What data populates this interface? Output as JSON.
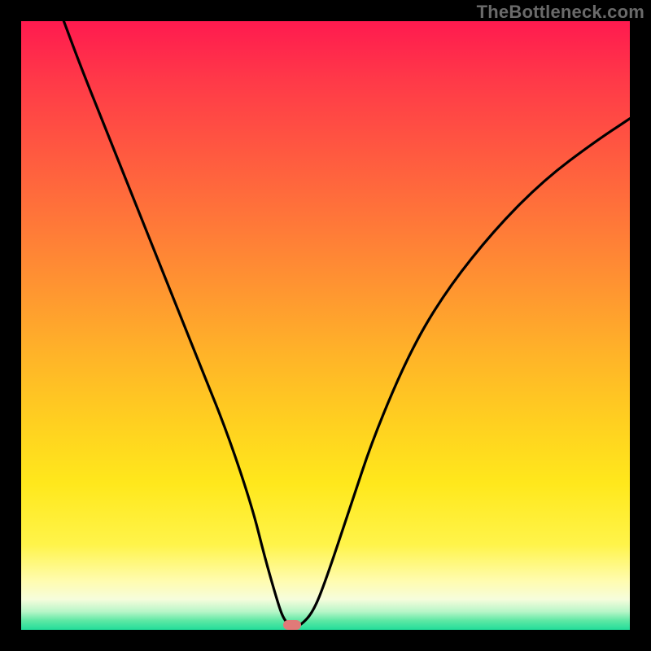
{
  "watermark": "TheBottleneck.com",
  "chart_data": {
    "type": "line",
    "title": "",
    "xlabel": "",
    "ylabel": "",
    "xlim": [
      0,
      100
    ],
    "ylim": [
      0,
      100
    ],
    "grid": false,
    "legend": false,
    "series": [
      {
        "name": "bottleneck-curve",
        "x": [
          7,
          10,
          14,
          18,
          22,
          26,
          30,
          34,
          38,
          40,
          42,
          43,
          44,
          45,
          46,
          48,
          50,
          54,
          58,
          64,
          70,
          78,
          86,
          94,
          100
        ],
        "y": [
          100,
          92,
          82,
          72,
          62,
          52,
          42,
          32,
          20,
          12,
          5,
          2,
          0.8,
          0.6,
          0.8,
          3,
          8,
          20,
          32,
          46,
          56,
          66,
          74,
          80,
          84
        ]
      }
    ],
    "marker": {
      "x_pct": 44.5,
      "y_pct": 0.8,
      "color": "#e07a78"
    },
    "colors": {
      "curve": "#000000",
      "frame": "#000000"
    }
  }
}
